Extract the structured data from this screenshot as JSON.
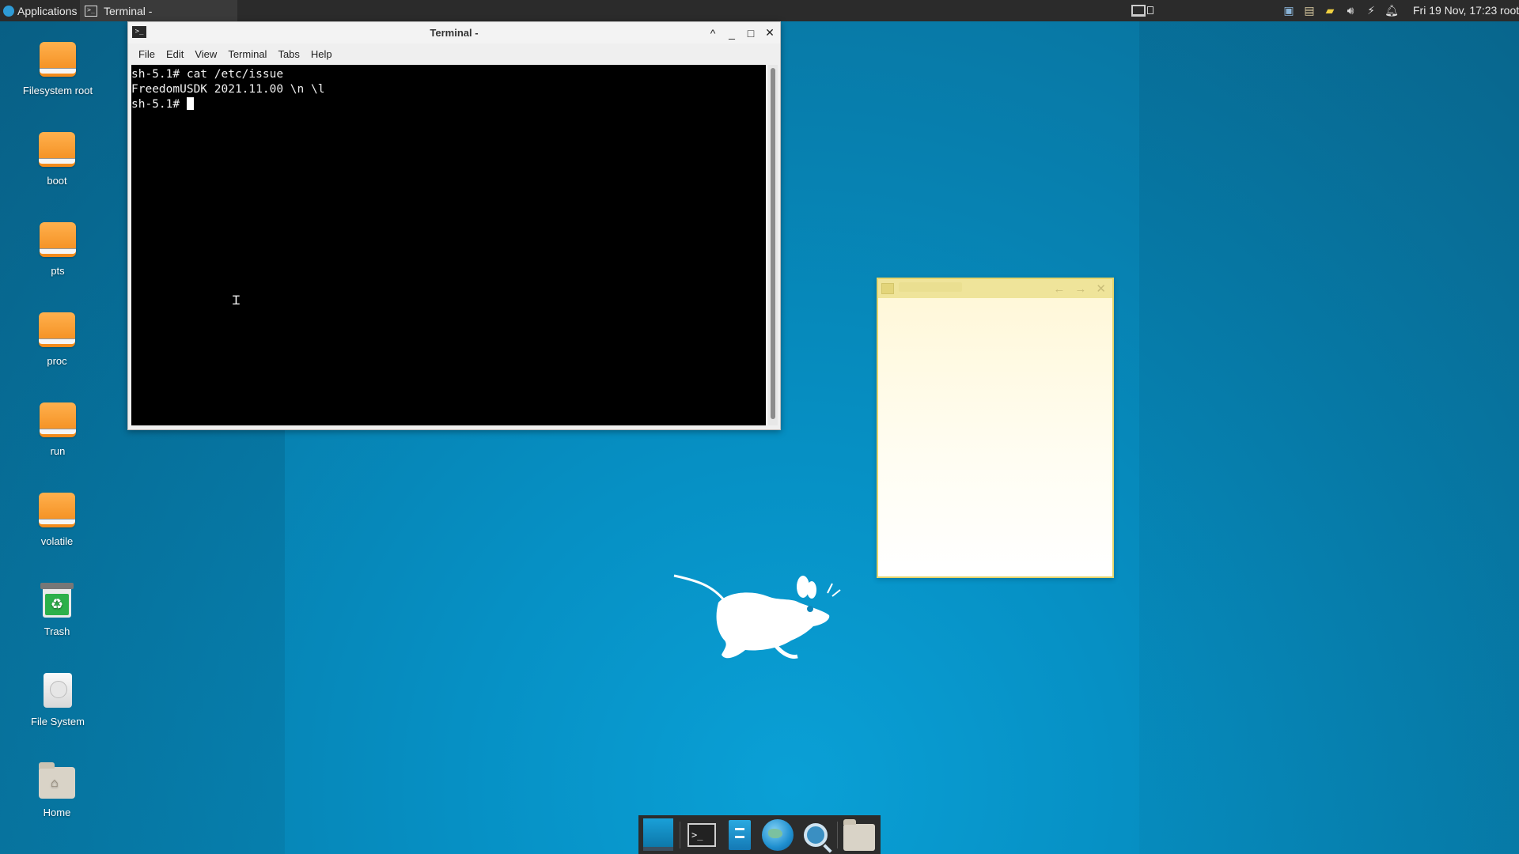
{
  "top_panel": {
    "applications_label": "Applications",
    "task_label": "Terminal -",
    "clock": "Fri 19 Nov, 17:23",
    "user": "root"
  },
  "desktop_icons": [
    {
      "label": "Filesystem root",
      "icon": "drive-icon"
    },
    {
      "label": "boot",
      "icon": "drive-icon"
    },
    {
      "label": "pts",
      "icon": "drive-icon"
    },
    {
      "label": "proc",
      "icon": "drive-icon"
    },
    {
      "label": "run",
      "icon": "drive-icon"
    },
    {
      "label": "volatile",
      "icon": "drive-icon"
    },
    {
      "label": "Trash",
      "icon": "trash-icon"
    },
    {
      "label": "File System",
      "icon": "harddisk-icon"
    },
    {
      "label": "Home",
      "icon": "home-folder-icon"
    }
  ],
  "terminal": {
    "title": "Terminal -",
    "menu": [
      "File",
      "Edit",
      "View",
      "Terminal",
      "Tabs",
      "Help"
    ],
    "lines": [
      "sh-5.1# cat /etc/issue",
      "FreedomUSDK 2021.11.00 \\n \\l",
      "",
      "sh-5.1# "
    ],
    "window_buttons": [
      "^",
      "_",
      "□",
      "✕"
    ]
  },
  "notes": {
    "buttons": [
      "←",
      "→",
      "✕"
    ]
  },
  "dock": {
    "items": [
      "show-desktop-icon",
      "terminal-icon",
      "file-manager-icon",
      "web-browser-icon",
      "app-finder-icon",
      "home-folder-icon"
    ]
  },
  "colors": {
    "desktop": "#0690c4",
    "panel": "#2b2b2b",
    "drive": "#f28a1a",
    "notes_bar": "#efe49a"
  }
}
